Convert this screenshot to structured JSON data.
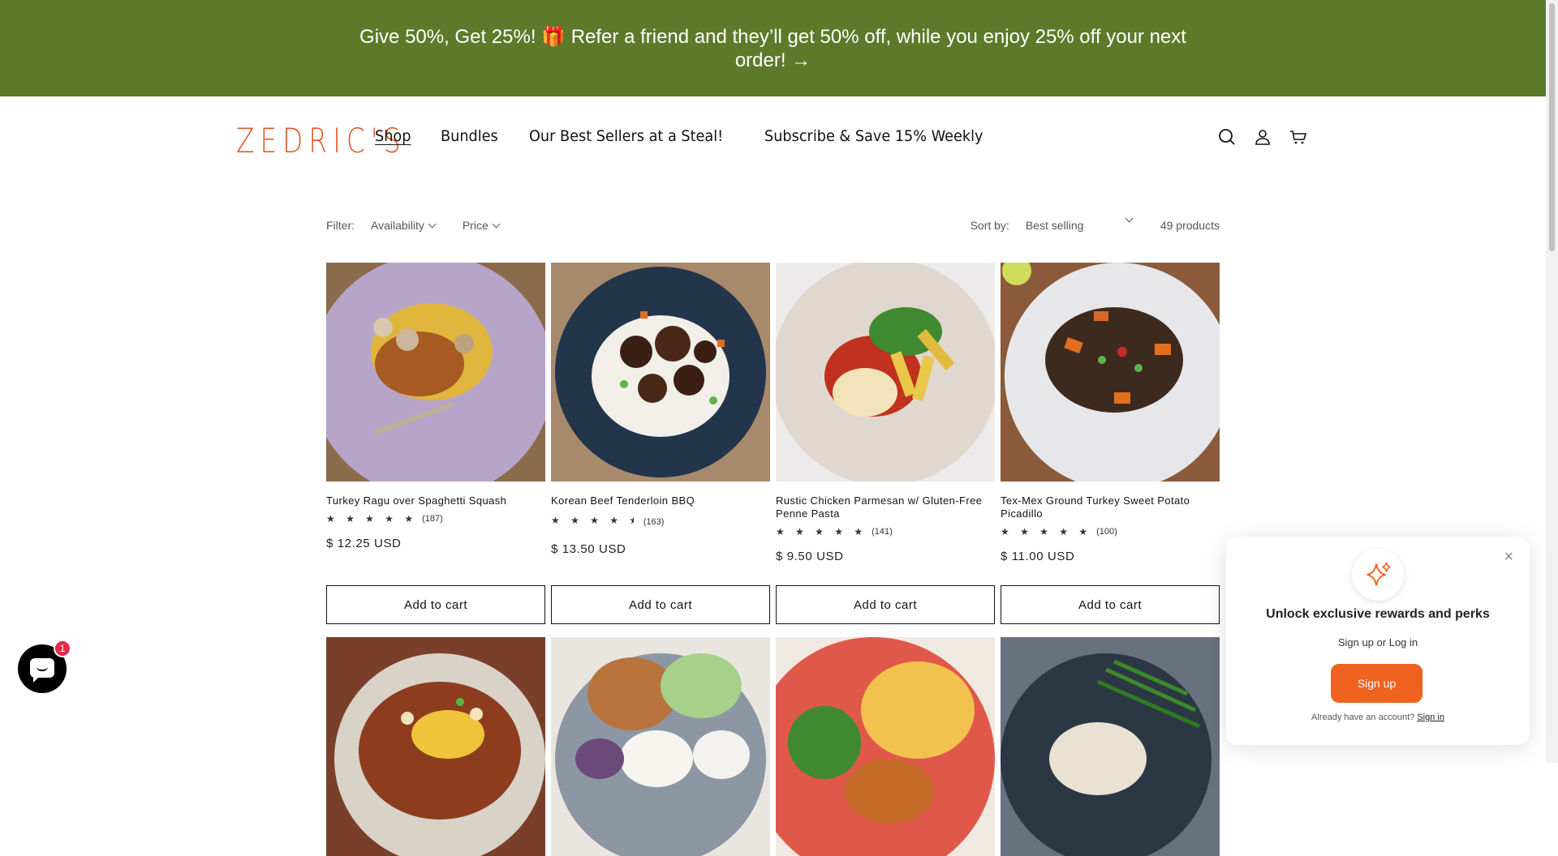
{
  "announcement": {
    "text": "Give 50%, Get 25%! 🎁 Refer a friend and they’ll get 50% off, while you enjoy 25% off your next order! →"
  },
  "brand": {
    "logo_text": "ZEDRIC'S",
    "accent": "#e2592a",
    "banner_color": "#5d7a2b"
  },
  "nav": {
    "items": [
      "Shop",
      "Bundles",
      "Our Best Sellers at a Steal!",
      "Subscribe & Save 15% Weekly"
    ]
  },
  "header_icons": [
    "search-icon",
    "account-icon",
    "cart-icon"
  ],
  "filter": {
    "label": "Filter:",
    "availability": "Availability",
    "price": "Price",
    "sort_label": "Sort by:",
    "sort_value": "Best selling",
    "count": "49 products"
  },
  "products": [
    {
      "title": "Turkey Ragu over Spaghetti Squash",
      "stars": "★ ★ ★ ★ ★",
      "rating": 5,
      "reviews": "(187)",
      "price": "$ 12.25 USD",
      "button": "Add to cart",
      "plate": "#b7a5c9"
    },
    {
      "title": "Korean Beef Tenderloin BBQ",
      "stars": "★ ★ ★ ★ ⯨",
      "rating": 4.5,
      "reviews": "(163)",
      "price": "$ 13.50 USD",
      "button": "Add to cart",
      "plate": "#23354b"
    },
    {
      "title": "Rustic Chicken Parmesan w/ Gluten-Free Penne Pasta",
      "stars": "★ ★ ★ ★ ★",
      "rating": 5,
      "reviews": "(141)",
      "price": "$ 9.50 USD",
      "button": "Add to cart",
      "plate": "#e0d8ce"
    },
    {
      "title": "Tex-Mex Ground Turkey Sweet Potato Picadillo",
      "stars": "★ ★ ★ ★ ★",
      "rating": 5,
      "reviews": "(100)",
      "price": "$ 11.00 USD",
      "button": "Add to cart",
      "plate": "#e7e7ea"
    },
    {
      "plate": "#d9d2c6"
    },
    {
      "plate": "#8c97a3"
    },
    {
      "plate": "#e0584a"
    },
    {
      "plate": "#2c3744"
    }
  ],
  "chat": {
    "badge": "1"
  },
  "popup": {
    "heading": "Unlock exclusive rewards and perks",
    "sub": "Sign up or Log in",
    "button": "Sign up",
    "footer_text": "Already have an account?",
    "footer_link": "Sign in",
    "close": "×"
  }
}
